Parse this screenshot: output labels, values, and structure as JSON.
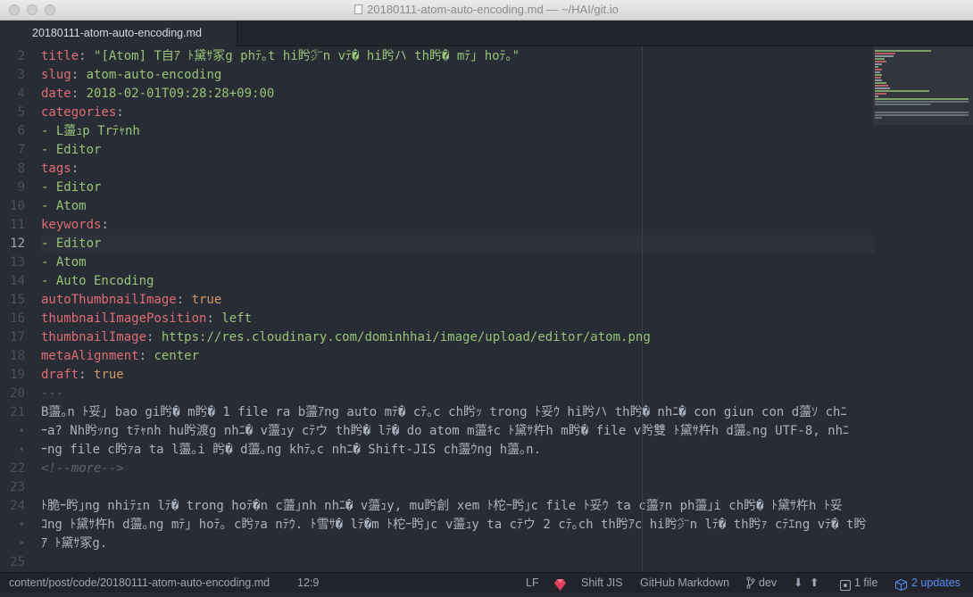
{
  "window": {
    "title": "20180111-atom-auto-encoding.md — ~/HAI/git.io"
  },
  "tab": {
    "label": "20180111-atom-auto-encoding.md"
  },
  "editor": {
    "cursor_line": 12,
    "lines": [
      {
        "num": "2",
        "key": "title",
        "val": "\"[Atom] T自ｱ ﾄ黛ｻ冢g phﾃ｡t hi盻㌻n vﾃ� hi盻ハ th盻� mﾃ｣ hoﾃ｡\""
      },
      {
        "num": "3",
        "key": "slug",
        "val": "atom-auto-encoding"
      },
      {
        "num": "4",
        "key": "date",
        "val": "2018-02-01T09:28:28+09:00"
      },
      {
        "num": "5",
        "key": "categories",
        "val": ""
      },
      {
        "num": "6",
        "item": "- L蘯ｭp Trﾃｬnh"
      },
      {
        "num": "7",
        "item": "- Editor"
      },
      {
        "num": "8",
        "key": "tags",
        "val": ""
      },
      {
        "num": "9",
        "item": "- Editor"
      },
      {
        "num": "10",
        "item": "- Atom"
      },
      {
        "num": "11",
        "key": "keywords",
        "val": ""
      },
      {
        "num": "12",
        "item": "- Editor"
      },
      {
        "num": "13",
        "item": "- Atom"
      },
      {
        "num": "14",
        "item": "- Auto Encoding"
      },
      {
        "num": "15",
        "key": "autoThumbnailImage",
        "val": "true"
      },
      {
        "num": "16",
        "key": "thumbnailImagePosition",
        "val": "left"
      },
      {
        "num": "17",
        "key": "thumbnailImage",
        "val": "https://res.cloudinary.com/dominhhai/image/upload/editor/atom.png"
      },
      {
        "num": "18",
        "key": "metaAlignment",
        "val": "center"
      },
      {
        "num": "19",
        "key": "draft",
        "val": "true"
      },
      {
        "num": "20",
        "comment": "---"
      },
      {
        "num": "21",
        "text": [
          "B蘯｡n ﾄ妥｣ bao gi盻� m盻� 1 file ra b蘯ｱng auto mﾃ� cﾃ｡c ch盻ｯ trong ﾄ妥ｳ hi盻ハ th盻� nhﾆ� con giun con d蘯ｿ chﾆ",
          "ｰa? Nh盻ｯng tﾃｬnh hu盻渡g nhﾆ� v蘯ｭy cﾃウ th盻� lﾃ� do atom m蘯ｷc ﾄ黛ｻ杵h m盻� file v盻雙 ﾄ黛ｻ杵h d蘯｡ng UTF-8, nhﾆ",
          "ｰng file c盻ｧa ta l蘯｡i 盻� d蘯｡ng khﾃ｡c nhﾆ� Shift-JIS ch蘯ｳng h蘯｡n."
        ]
      },
      {
        "num": "22",
        "comment": "<!--more-->"
      },
      {
        "num": "23"
      },
      {
        "num": "24",
        "text": [
          "ﾄ脆ｰ盻｣ng nhiﾃｪn lﾃ� trong hoﾃ�n c蘯｣nh nhﾆ� v蘯ｭy, mu盻創 xem ﾄ柁ｰ盻｣c file ﾄ妥ｳ ta c蘯ｧn ph蘯｣i ch盻� ﾄ黛ｻ杵h ﾄ妥",
          "ｺng ﾄ黛ｻ杵h d蘯｡ng mﾃ｣ hoﾃ｡ c盻ｧa nﾃｳ. ﾄ雪ｻ� lﾃ�m ﾄ柁ｰ盻｣c v蘯ｭy ta cﾃウ 2 cﾃ｡ch th盻ｱc hi盻㌻n lﾃ� th盻ｧ cﾃｴng vﾃ� t盻",
          "ｱ ﾄ黛ｻ冢g."
        ]
      },
      {
        "num": "25"
      }
    ]
  },
  "status": {
    "path": "content/post/code/20180111-atom-auto-encoding.md",
    "cursor": "12:9",
    "line_ending": "LF",
    "encoding": "Shift JIS",
    "grammar": "GitHub Markdown",
    "branch": "dev",
    "files": "1 file",
    "updates": "2 updates"
  },
  "icons": {
    "git_branch": "git-branch-icon",
    "fetch": "arrow-down-icon",
    "push": "arrow-up-icon",
    "diff": "file-diff-icon",
    "package": "package-icon",
    "ruby": "ruby-icon"
  },
  "colors": {
    "key": "#e06c75",
    "string": "#98c379",
    "number": "#d19a66",
    "comment": "#5c6370",
    "text": "#abb2bf",
    "accent": "#568af2"
  }
}
